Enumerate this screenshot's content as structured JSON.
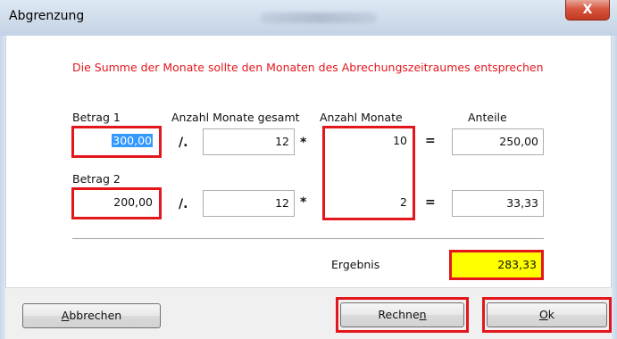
{
  "window": {
    "title": "Abgrenzung",
    "close_glyph": "X"
  },
  "message": "Die Summe der Monate sollte den Monaten des Abrechungszeitraumes entsprechen",
  "headers": {
    "betrag1": "Betrag 1",
    "monate_gesamt": "Anzahl Monate gesamt",
    "monate": "Anzahl Monate",
    "anteile": "Anteile",
    "betrag2": "Betrag 2"
  },
  "rows": [
    {
      "betrag": "300,00",
      "div_op": "/.",
      "gesamt": "12",
      "mul_op": "*",
      "monate": "10",
      "eq_op": "=",
      "anteil": "250,00"
    },
    {
      "betrag": "200,00",
      "div_op": "/.",
      "gesamt": "12",
      "mul_op": "*",
      "monate": "2",
      "eq_op": "=",
      "anteil": "33,33"
    }
  ],
  "result": {
    "label": "Ergebnis",
    "value": "283,33",
    "bg": "#ffff00"
  },
  "buttons": {
    "cancel": {
      "pre": "",
      "key": "A",
      "post": "bbrechen"
    },
    "calc": {
      "pre": "Rechne",
      "key": "n",
      "post": ""
    },
    "ok": {
      "pre": "",
      "key": "O",
      "post": "k"
    }
  },
  "colors": {
    "highlight": "#e3161c",
    "warning_text": "#e3161c"
  }
}
